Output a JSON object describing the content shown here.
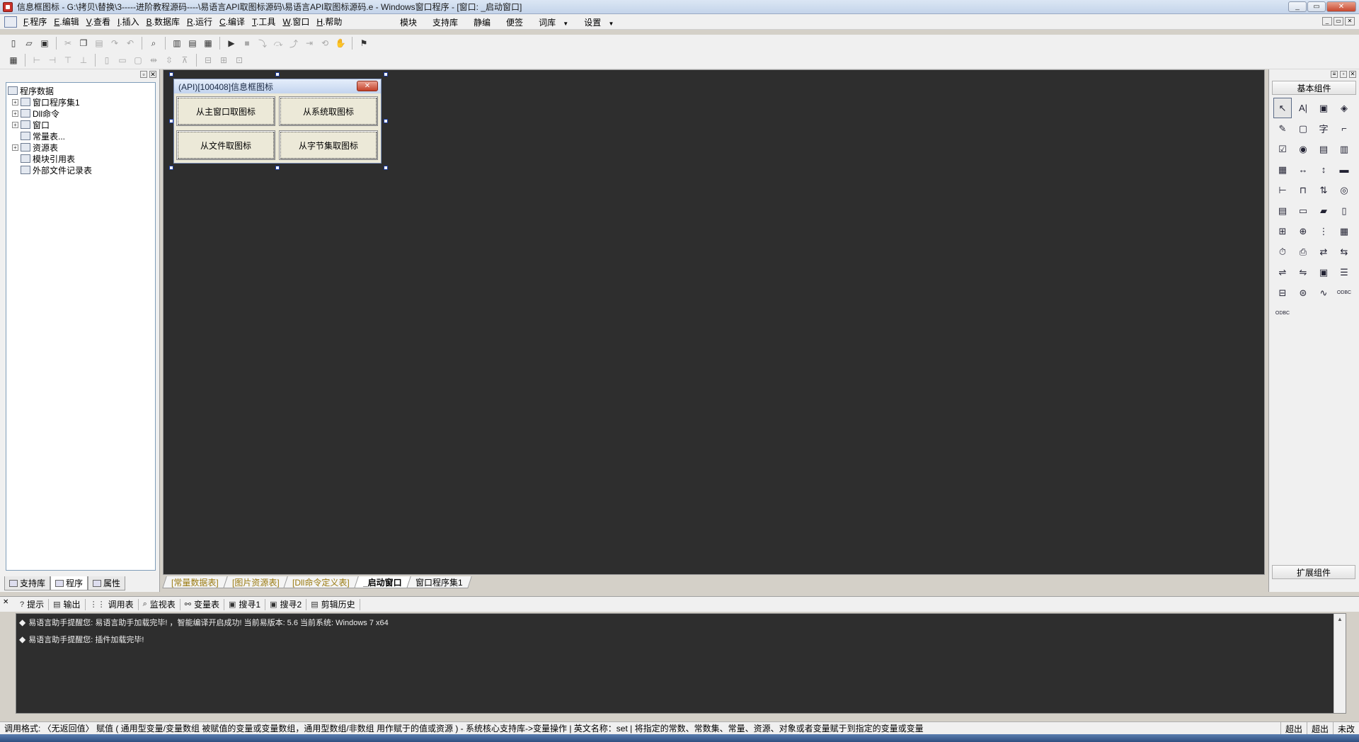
{
  "window": {
    "title": "信息框图标 - G:\\拷贝\\替换\\3-----进阶教程源码----\\易语言API取图标源码\\易语言API取图标源码.e - Windows窗口程序 - [窗口: _启动窗口]",
    "minimize": "_",
    "maximize": "▭",
    "close": "✕"
  },
  "menu": {
    "items": [
      {
        "key": "F",
        "label": ".程序"
      },
      {
        "key": "E",
        "label": ".编辑"
      },
      {
        "key": "V",
        "label": ".查看"
      },
      {
        "key": "I",
        "label": ".插入"
      },
      {
        "key": "B",
        "label": ".数据库"
      },
      {
        "key": "R",
        "label": ".运行"
      },
      {
        "key": "C",
        "label": ".编译"
      },
      {
        "key": "T",
        "label": ".工具"
      },
      {
        "key": "W",
        "label": ".窗口"
      },
      {
        "key": "H",
        "label": ".帮助"
      }
    ],
    "right_items": [
      {
        "label": "模块"
      },
      {
        "label": "支持库"
      },
      {
        "label": "静编"
      },
      {
        "label": "便签"
      },
      {
        "label": "词库"
      },
      {
        "label": "设置"
      }
    ]
  },
  "tree": {
    "items": [
      {
        "label": "程序数据",
        "level": 0,
        "expand": ""
      },
      {
        "label": "窗口程序集1",
        "level": 1,
        "expand": "+"
      },
      {
        "label": "Dll命令",
        "level": 1,
        "expand": "+"
      },
      {
        "label": "窗口",
        "level": 1,
        "expand": "+"
      },
      {
        "label": "常量表...",
        "level": 1,
        "expand": ""
      },
      {
        "label": "资源表",
        "level": 1,
        "expand": "+"
      },
      {
        "label": "模块引用表",
        "level": 2,
        "expand": ""
      },
      {
        "label": "外部文件记录表",
        "level": 2,
        "expand": ""
      }
    ]
  },
  "left_tabs": [
    {
      "label": "支持库"
    },
    {
      "label": "程序"
    },
    {
      "label": "属性"
    }
  ],
  "design_window": {
    "title": "(API)[100408]信息框图标",
    "buttons": [
      {
        "label": "从主窗口取图标"
      },
      {
        "label": "从系统取图标"
      },
      {
        "label": "从文件取图标"
      },
      {
        "label": "从字节集取图标"
      }
    ]
  },
  "canvas_tabs": [
    {
      "label": "[常量数据表]"
    },
    {
      "label": "[图片资源表]"
    },
    {
      "label": "[Dll命令定义表]"
    },
    {
      "label": "_启动窗口"
    },
    {
      "label": "窗口程序集1"
    }
  ],
  "palette": {
    "category": "基本组件",
    "extension": "扩展组件",
    "components": [
      {
        "icon": "pointer-icon",
        "glyph": "↖"
      },
      {
        "icon": "label-icon",
        "glyph": "A|"
      },
      {
        "icon": "picture-icon",
        "glyph": "▣"
      },
      {
        "icon": "shape-icon",
        "glyph": "◈"
      },
      {
        "icon": "edit-icon",
        "glyph": "✎"
      },
      {
        "icon": "groupbox-icon",
        "glyph": "▢"
      },
      {
        "icon": "text-icon",
        "glyph": "字"
      },
      {
        "icon": "line-icon",
        "glyph": "⌐"
      },
      {
        "icon": "checkbox-icon",
        "glyph": "☑"
      },
      {
        "icon": "radio-icon",
        "glyph": "◉"
      },
      {
        "icon": "combobox-icon",
        "glyph": "▤"
      },
      {
        "icon": "listbox-icon",
        "glyph": "▥"
      },
      {
        "icon": "grid-icon",
        "glyph": "▦"
      },
      {
        "icon": "hscroll-icon",
        "glyph": "↔"
      },
      {
        "icon": "vscroll-icon",
        "glyph": "↕"
      },
      {
        "icon": "progress-icon",
        "glyph": "▬"
      },
      {
        "icon": "slider-icon",
        "glyph": "⊢"
      },
      {
        "icon": "tab-icon",
        "glyph": "⊓"
      },
      {
        "icon": "updown-icon",
        "glyph": "⇅"
      },
      {
        "icon": "image-icon",
        "glyph": "◎"
      },
      {
        "icon": "table-icon",
        "glyph": "▤"
      },
      {
        "icon": "input-icon",
        "glyph": "▭"
      },
      {
        "icon": "folder-icon",
        "glyph": "▰"
      },
      {
        "icon": "doc-icon",
        "glyph": "▯"
      },
      {
        "icon": "tree-icon",
        "glyph": "⊞"
      },
      {
        "icon": "network-icon",
        "glyph": "⊕"
      },
      {
        "icon": "split-icon",
        "glyph": "⋮"
      },
      {
        "icon": "calendar-icon",
        "glyph": "▦"
      },
      {
        "icon": "timer-icon",
        "glyph": "⏱"
      },
      {
        "icon": "printer-icon",
        "glyph": "⎙"
      },
      {
        "icon": "client-icon",
        "glyph": "⇄"
      },
      {
        "icon": "server-icon",
        "glyph": "⇆"
      },
      {
        "icon": "port-icon",
        "glyph": "⇌"
      },
      {
        "icon": "dde-icon",
        "glyph": "⇋"
      },
      {
        "icon": "frame-icon",
        "glyph": "▣"
      },
      {
        "icon": "toolbar-icon",
        "glyph": "☰"
      },
      {
        "icon": "db-icon",
        "glyph": "⊟"
      },
      {
        "icon": "dbprovider-icon",
        "glyph": "⊜"
      },
      {
        "icon": "chart-icon",
        "glyph": "∿"
      },
      {
        "icon": "odbc-icon",
        "glyph": "ODBC"
      },
      {
        "icon": "odbc2-icon",
        "glyph": "ODBC"
      }
    ]
  },
  "output_tabs": [
    {
      "label": "提示",
      "icon": "?"
    },
    {
      "label": "输出",
      "icon": "▤"
    },
    {
      "label": "调用表",
      "icon": "⋮⋮"
    },
    {
      "label": "监视表",
      "icon": "⌕"
    },
    {
      "label": "变量表",
      "icon": "⚯"
    },
    {
      "label": "搜寻1",
      "icon": "▣"
    },
    {
      "label": "搜寻2",
      "icon": "▣"
    },
    {
      "label": "剪辑历史",
      "icon": "▤"
    }
  ],
  "output_lines": [
    {
      "text": "易语言助手提醒您: 易语言助手加载完毕! ，智能编译开启成功! 当前易版本: 5.6  当前系统: Windows 7 x64"
    },
    {
      "text": "易语言助手提醒您: 插件加载完毕!"
    }
  ],
  "status": {
    "text": "调用格式: 〈无返回值〉 赋值 ( 通用型变量/变量数组 被赋值的变量或变量数组，通用型数组/非数组 用作赋于的值或资源 ) - 系统核心支持库->变量操作  |  英文名称：set  |  将指定的常数、常数集、常量、资源、对象或者变量赋于到指定的变量或变量",
    "cells": [
      {
        "label": "超出"
      },
      {
        "label": "超出"
      },
      {
        "label": "未改"
      }
    ]
  }
}
